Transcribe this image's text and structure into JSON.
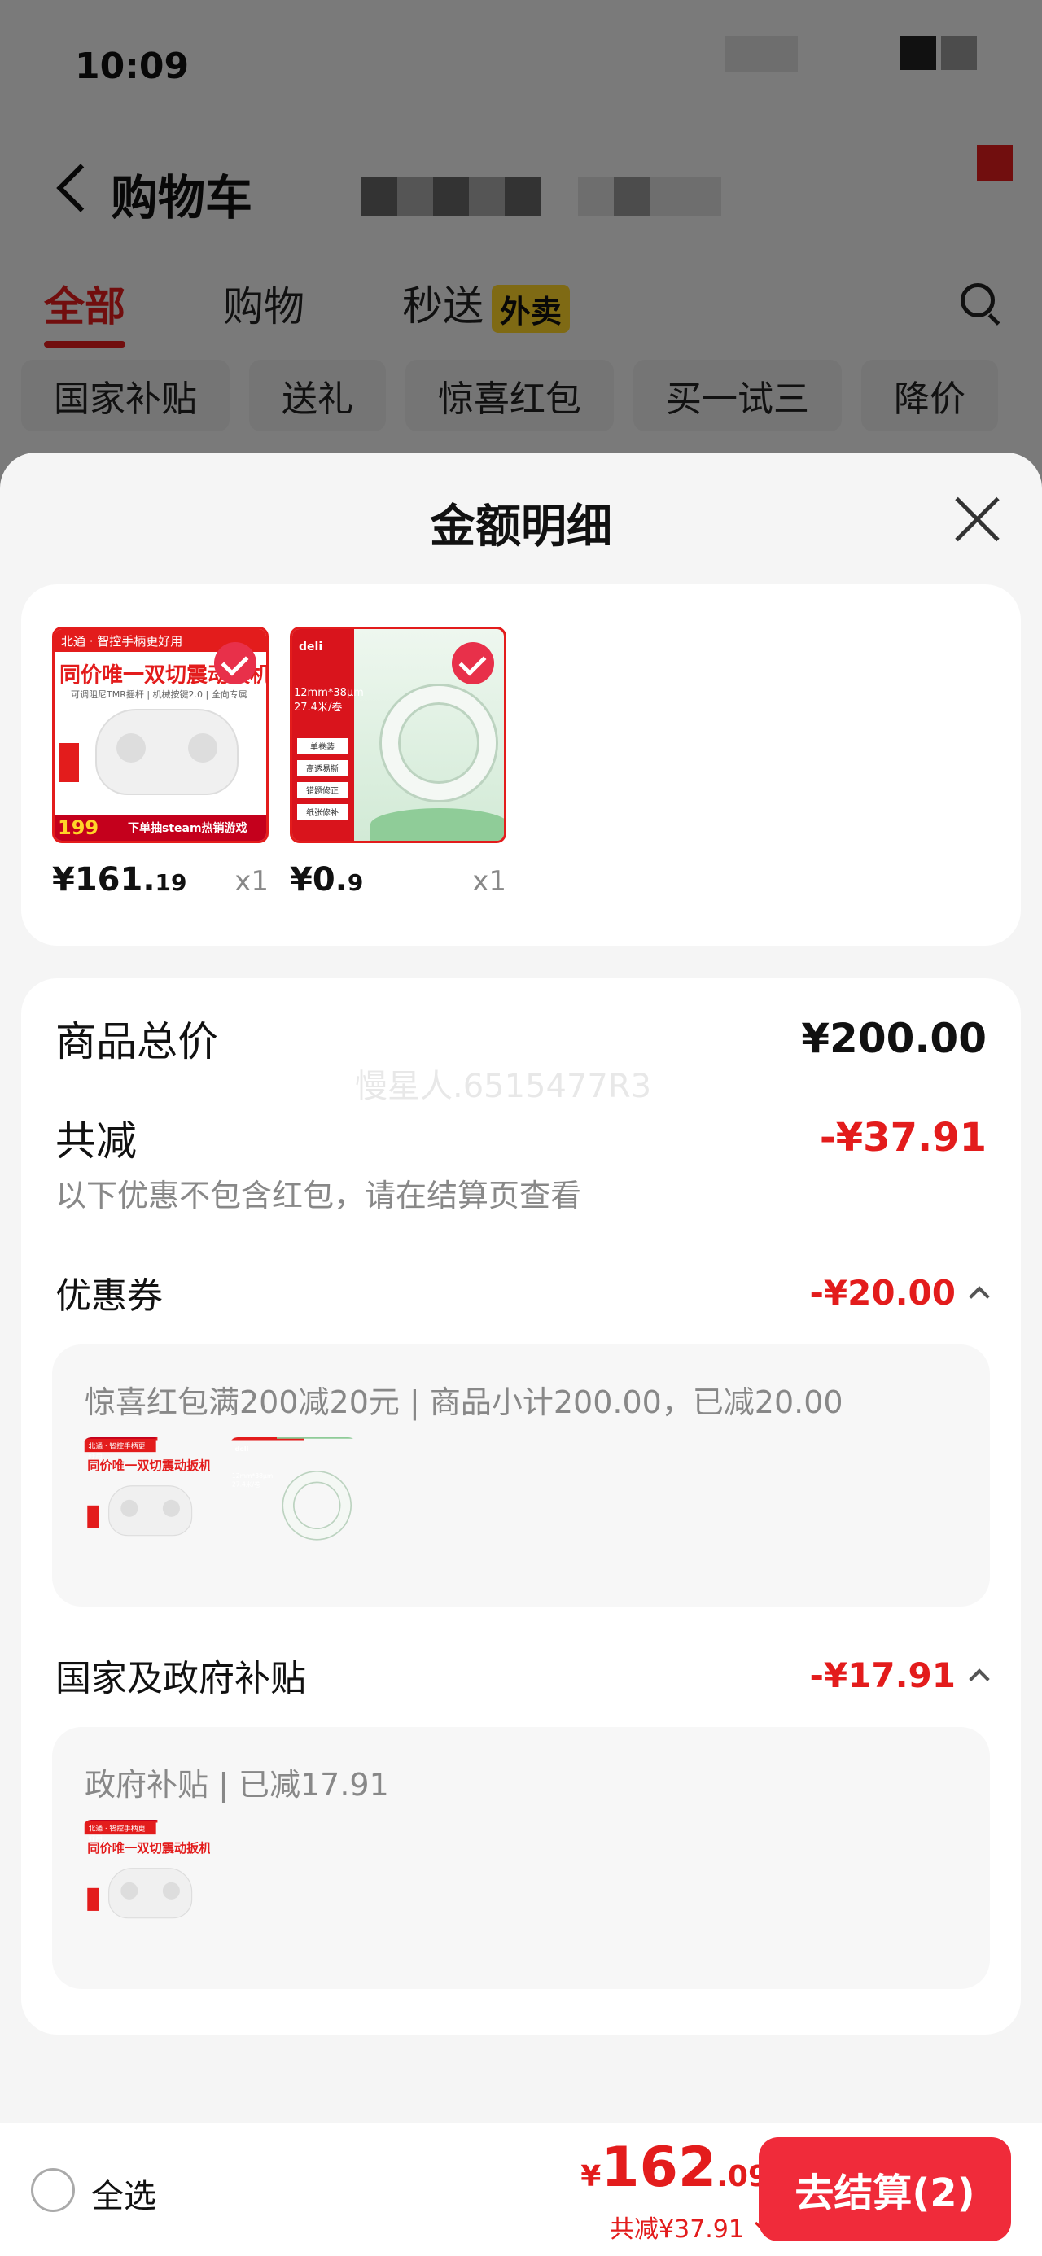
{
  "status_bar": {
    "time": "10:09"
  },
  "header": {
    "title": "购物车"
  },
  "tabs": [
    {
      "label": "全部",
      "active": true
    },
    {
      "label": "购物",
      "active": false
    },
    {
      "label": "秒送",
      "active": false,
      "badge": "外卖"
    }
  ],
  "chips": [
    "国家补贴",
    "送礼",
    "惊喜红包",
    "买一试三",
    "降价"
  ],
  "sheet": {
    "title": "金额明细",
    "products": [
      {
        "price_int": "¥161.",
        "price_dec": "19",
        "qty": "x1",
        "thumb": {
          "head": "北通 · 智控手柄更好用",
          "headline": "同价唯一双切震动扳机",
          "sub": "可调阻尼TMR摇杆 | 机械按键2.0 | 全向专属",
          "bottom": "下单抽steam热销游戏",
          "price": "199"
        }
      },
      {
        "price_int": "¥0.",
        "price_dec": "9",
        "qty": "x1",
        "thumb": {
          "logo": "deli",
          "spec1": "12mm*38μm",
          "spec2": "27.4米/卷",
          "menu": [
            "单卷装",
            "高透易撕",
            "错题修正",
            "纸张修补"
          ]
        }
      }
    ],
    "summary": {
      "total_label": "商品总价",
      "total_value": "¥200.00",
      "watermark": "慢星人.6515477R3",
      "discount_label": "共减",
      "discount_value": "-¥37.91",
      "discount_note": "以下优惠不包含红包，请在结算页查看",
      "coupon_label": "优惠券",
      "coupon_value": "-¥20.00",
      "coupon_detail": "惊喜红包满200减20元 | 商品小计200.00，已减20.00",
      "subsidy_label": "国家及政府补贴",
      "subsidy_value": "-¥17.91",
      "subsidy_detail": "政府补贴 | 已减17.91"
    }
  },
  "bottom_bar": {
    "select_all": "全选",
    "currency": "¥",
    "total_int": "162",
    "total_dec": ".09",
    "saved": "共减¥37.91",
    "checkout": "去结算(2)"
  },
  "colors": {
    "accent": "#e31c1c",
    "checkout": "#f02b3a",
    "badge": "#ffd428"
  }
}
